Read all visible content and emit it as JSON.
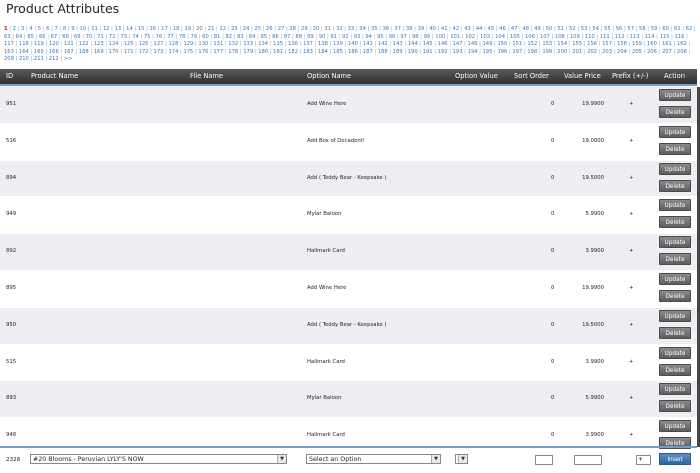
{
  "page": {
    "title": "Product Attributes"
  },
  "pagination": {
    "current": "1",
    "more_label": ">>",
    "last_page": 212
  },
  "table": {
    "headers": {
      "id": "ID",
      "product_name": "Product Name",
      "file_name": "File Name",
      "option_name": "Option Name",
      "option_value": "Option Value",
      "sort_order": "Sort Order",
      "value_price": "Value Price",
      "prefix": "Prefix (+/-)",
      "action": "Action"
    },
    "rows": [
      {
        "id": "951",
        "option_name": "Add Wine Here",
        "sort_order": "0",
        "value_price": "19.9900",
        "prefix": "+"
      },
      {
        "id": "516",
        "option_name": "Add Box of Decadent!",
        "sort_order": "0",
        "value_price": "19.0000",
        "prefix": "+"
      },
      {
        "id": "894",
        "option_name": "Add ( Teddy Bear - Keepsake )",
        "sort_order": "0",
        "value_price": "19.5000",
        "prefix": "+"
      },
      {
        "id": "949",
        "option_name": "Mylar Baloon",
        "sort_order": "0",
        "value_price": "5.9900",
        "prefix": "+"
      },
      {
        "id": "892",
        "option_name": "Hallmark Card",
        "sort_order": "0",
        "value_price": "3.9900",
        "prefix": "+"
      },
      {
        "id": "895",
        "option_name": "Add Wine Here",
        "sort_order": "0",
        "value_price": "19.9900",
        "prefix": "+"
      },
      {
        "id": "950",
        "option_name": "Add ( Teddy Bear - Keepsake )",
        "sort_order": "0",
        "value_price": "19.5000",
        "prefix": "+"
      },
      {
        "id": "515",
        "option_name": "Hallmark Card",
        "sort_order": "0",
        "value_price": "3.9900",
        "prefix": "+"
      },
      {
        "id": "893",
        "option_name": "Mylar Baloon",
        "sort_order": "0",
        "value_price": "5.9900",
        "prefix": "+"
      },
      {
        "id": "948",
        "option_name": "Hallmark Card",
        "sort_order": "0",
        "value_price": "3.9900",
        "prefix": "+"
      }
    ],
    "update_label": "Update",
    "delete_label": "Delete"
  },
  "insert": {
    "new_id": "2328",
    "product_select": "#20 Blooms - Peruvian LYLY'S NOW",
    "option_select": "Select an Option",
    "value_select": "",
    "sort_order": "",
    "value_price": "",
    "prefix": "+",
    "insert_label": "Insert"
  },
  "colors": {
    "header_bg": "#3f3f3f",
    "accent_rule": "#6fa0c9",
    "row_alt": "#ededf3",
    "link": "#3b78b5",
    "current_page": "#cc1111",
    "insert_button": "#3d74ad"
  },
  "icons": {
    "select_arrow": "chevron-down-icon"
  }
}
